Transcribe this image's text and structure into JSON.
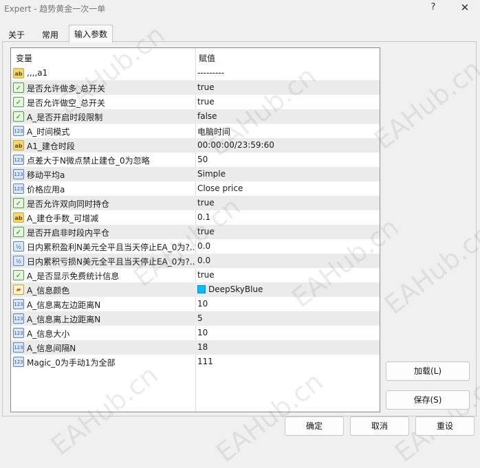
{
  "window": {
    "title": "Expert - 趋势黄金一次一单",
    "help_glyph": "?",
    "close_glyph": "✕"
  },
  "tabs": [
    {
      "label": "关于"
    },
    {
      "label": "常用"
    },
    {
      "label": "输入参数",
      "active": true
    }
  ],
  "grid": {
    "headers": {
      "variable": "变量",
      "value": "赋值"
    },
    "rows": [
      {
        "icon": "string-icon",
        "glyph": "ab",
        "name": ",,,,a1",
        "value": "---------"
      },
      {
        "icon": "bool-icon",
        "glyph": "✓",
        "name": "是否允许做多_总开关",
        "value": "true"
      },
      {
        "icon": "bool-icon",
        "glyph": "✓",
        "name": "是否允许做空_总开关",
        "value": "true"
      },
      {
        "icon": "bool-icon",
        "glyph": "✓",
        "name": "A_是否开启时段限制",
        "value": "false"
      },
      {
        "icon": "int-icon",
        "glyph": "123",
        "name": "A_时间模式",
        "value": "电脑时间"
      },
      {
        "icon": "string-icon",
        "glyph": "ab",
        "name": "A1_建仓时段",
        "value": "00:00:00/23:59:60"
      },
      {
        "icon": "int-icon",
        "glyph": "123",
        "name": "点差大于N微点禁止建仓_0为忽略",
        "value": "50"
      },
      {
        "icon": "int-icon",
        "glyph": "123",
        "name": "移动平均a",
        "value": "Simple"
      },
      {
        "icon": "int-icon",
        "glyph": "123",
        "name": "价格应用a",
        "value": "Close price"
      },
      {
        "icon": "bool-icon",
        "glyph": "✓",
        "name": "是否允许双向同时持仓",
        "value": "true"
      },
      {
        "icon": "string-icon",
        "glyph": "ab",
        "name": "A_建仓手数_可增减",
        "value": "0.1"
      },
      {
        "icon": "bool-icon",
        "glyph": "✓",
        "name": "是否开启非时段内平仓",
        "value": "true"
      },
      {
        "icon": "double-icon",
        "glyph": "½",
        "name": "日内累积盈利N美元全平且当天停止EA_0为?..",
        "value": "0.0"
      },
      {
        "icon": "double-icon",
        "glyph": "½",
        "name": "日内累积亏损N美元全平且当天停止EA_0为?..",
        "value": "0.0"
      },
      {
        "icon": "bool-icon",
        "glyph": "✓",
        "name": "A_是否显示免费统计信息",
        "value": "true"
      },
      {
        "icon": "color-icon",
        "glyph": "▰",
        "name": "A_信息颜色",
        "value": "DeepSkyBlue",
        "swatch": "#00bfff"
      },
      {
        "icon": "int-icon",
        "glyph": "123",
        "name": "A_信息离左边距离N",
        "value": "10"
      },
      {
        "icon": "int-icon",
        "glyph": "123",
        "name": "A_信息离上边距离N",
        "value": "5"
      },
      {
        "icon": "int-icon",
        "glyph": "123",
        "name": "A_信息大小",
        "value": "10"
      },
      {
        "icon": "int-icon",
        "glyph": "123",
        "name": "A_信息间隔N",
        "value": "18"
      },
      {
        "icon": "int-icon",
        "glyph": "123",
        "name": "Magic_0为手动1为全部",
        "value": "111"
      }
    ]
  },
  "buttons": {
    "load": "加载(L)",
    "save": "保存(S)",
    "ok": "确定",
    "cancel": "取消",
    "reset": "重设"
  },
  "watermark": "EAHub.cn"
}
